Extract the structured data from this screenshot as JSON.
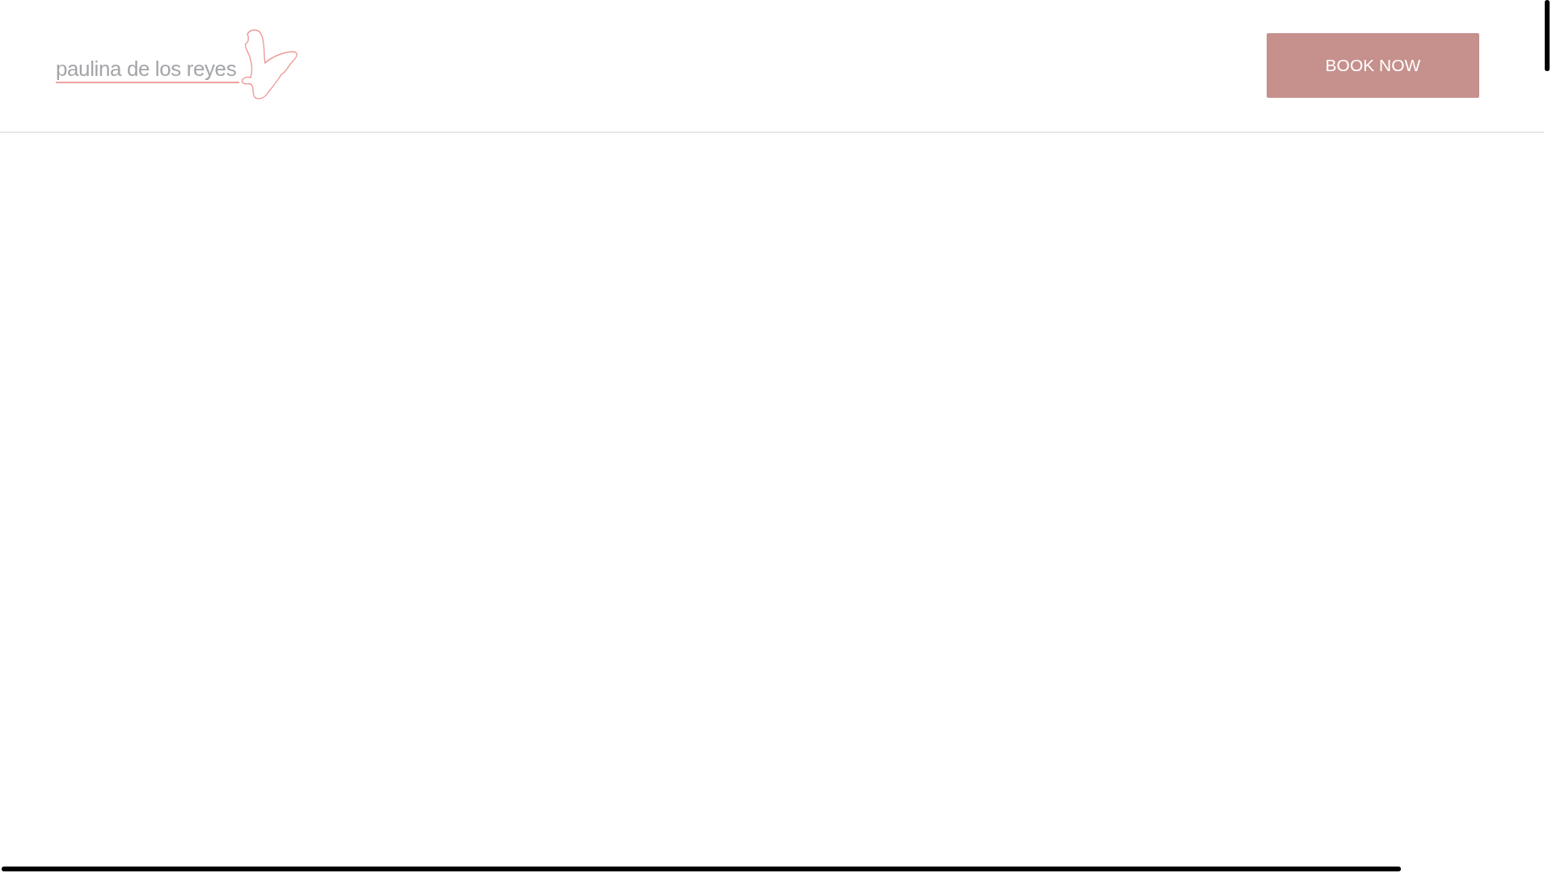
{
  "header": {
    "logo": {
      "text": "paulina de los reyes"
    },
    "button": {
      "label": "BOOK NOW"
    }
  }
}
